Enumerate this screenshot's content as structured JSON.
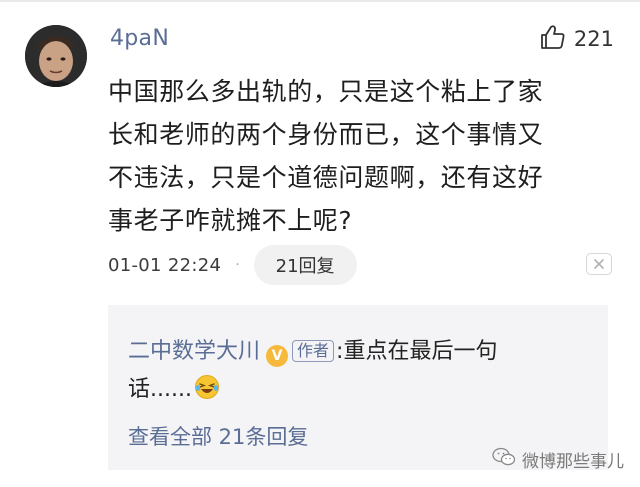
{
  "comment": {
    "username": "4paN",
    "like_count": "221",
    "text_lines": [
      "中国那么多出轨的，只是这个粘上了家",
      "长和老师的两个身份而已，这个事情又",
      "不违法，只是个道德问题啊，还有这好",
      "事老子咋就摊不上呢?"
    ],
    "timestamp": "01-01 22:24",
    "separator": "·",
    "reply_button_label": "21回复"
  },
  "reply": {
    "author_name": "二中数学大川",
    "verified_glyph": "V",
    "author_tag": "作者",
    "text_line1": ":重点在最后一句",
    "text_line2": "话......",
    "emoji_name": "laughing-crying-emoji",
    "view_all_label": "查看全部 21条回复"
  },
  "watermark": {
    "text": "微博那些事儿"
  },
  "icons": {
    "like": "thumbs-up-icon",
    "close": "close-x-icon",
    "watermark": "wechat-icon"
  },
  "colors": {
    "link_blue": "#5a6d95",
    "text_dark": "#1e1e1e",
    "reply_bg": "#f4f4f6",
    "verified_gold": "#f6b93b"
  }
}
